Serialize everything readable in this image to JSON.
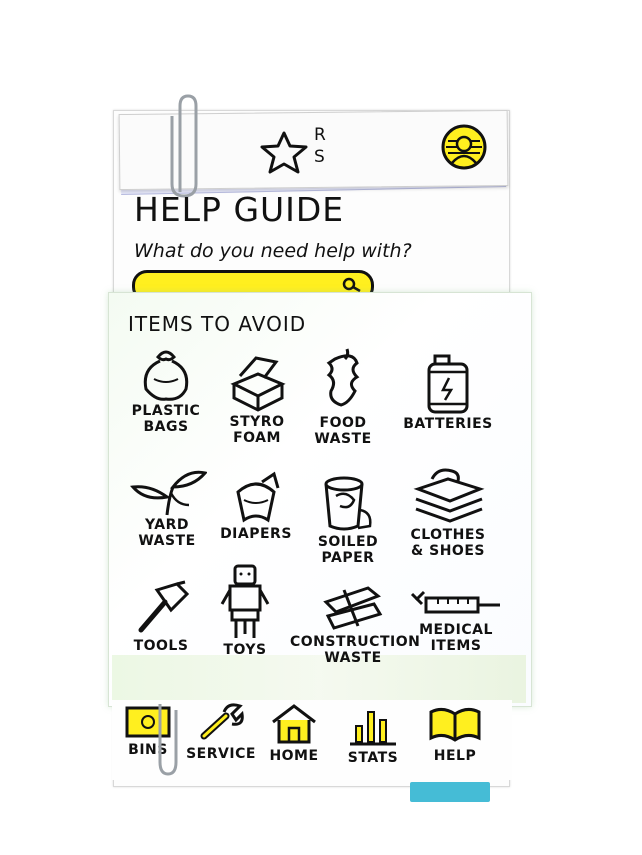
{
  "header": {
    "logo_letters": [
      "R",
      "S"
    ],
    "avatar": "user-avatar-icon"
  },
  "page": {
    "title": "HELP GUIDE",
    "question": "What do you need help with?"
  },
  "search": {
    "value": "",
    "placeholder": "",
    "icon": "search-icon"
  },
  "avoid": {
    "title": "ITEMS TO AVOID",
    "items": [
      {
        "label": "PLASTIC\nBAGS",
        "icon": "plastic-bag-icon"
      },
      {
        "label": "STYRO\nFOAM",
        "icon": "styrofoam-icon"
      },
      {
        "label": "FOOD\nWASTE",
        "icon": "food-waste-icon"
      },
      {
        "label": "BATTERIES",
        "icon": "battery-icon"
      },
      {
        "label": "YARD\nWASTE",
        "icon": "yard-waste-icon"
      },
      {
        "label": "DIAPERS",
        "icon": "diaper-icon"
      },
      {
        "label": "SOILED\nPAPER",
        "icon": "soiled-paper-icon"
      },
      {
        "label": "CLOTHES\n& SHOES",
        "icon": "clothes-icon"
      },
      {
        "label": "TOOLS",
        "icon": "hammer-icon"
      },
      {
        "label": "TOYS",
        "icon": "toy-icon"
      },
      {
        "label": "CONSTRUCTION\nWASTE",
        "icon": "construction-waste-icon"
      },
      {
        "label": "MEDICAL\nITEMS",
        "icon": "syringe-icon"
      }
    ]
  },
  "nav": {
    "items": [
      {
        "label": "BINS",
        "icon": "bin-icon"
      },
      {
        "label": "SERVICE",
        "icon": "wrench-icon"
      },
      {
        "label": "HOME",
        "icon": "home-icon"
      },
      {
        "label": "STATS",
        "icon": "stats-icon"
      },
      {
        "label": "HELP",
        "icon": "book-icon"
      }
    ]
  },
  "colors": {
    "highlight": "#ffef1f",
    "ink": "#111111",
    "tab": "#45bcd6",
    "panel_tint": "#eaf7e1"
  }
}
